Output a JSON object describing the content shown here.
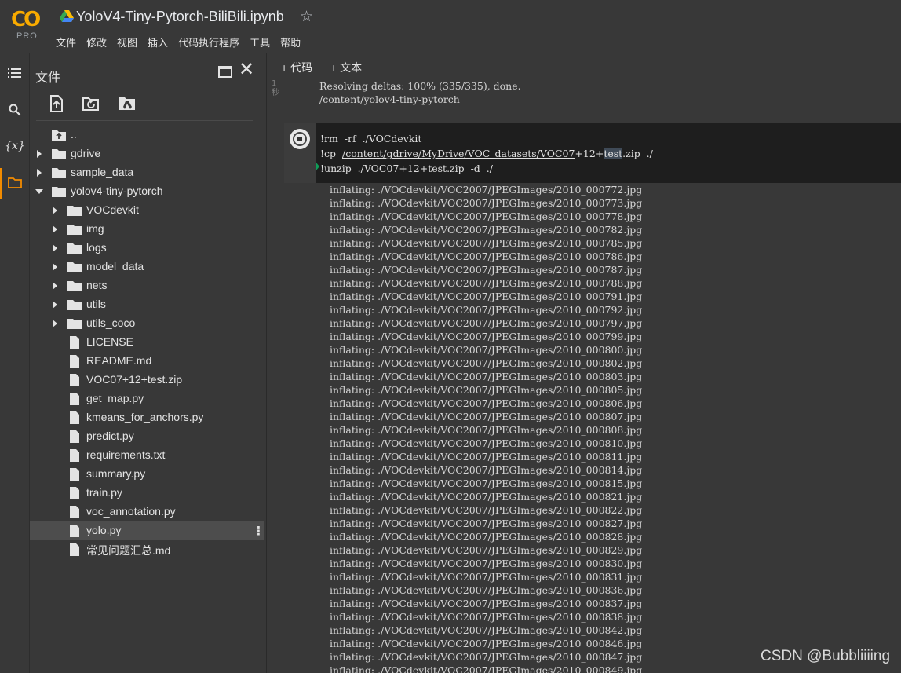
{
  "header": {
    "logo_text": "CO",
    "logo_badge": "PRO",
    "notebook_title": "YoloV4-Tiny-Pytorch-BiliBili.ipynb",
    "menu": [
      "文件",
      "修改",
      "视图",
      "插入",
      "代码执行程序",
      "工具",
      "帮助"
    ]
  },
  "rail": {
    "icons": [
      "menu-icon",
      "search-icon",
      "variables-icon",
      "folder-icon"
    ],
    "variables_glyph": "{x}"
  },
  "sidebar": {
    "title": "文件",
    "tools": [
      "upload-icon",
      "refresh-icon",
      "mount-drive-icon"
    ],
    "tree": [
      {
        "label": "..",
        "type": "up",
        "depth": 0,
        "caret": "none"
      },
      {
        "label": "gdrive",
        "type": "folder",
        "depth": 0,
        "caret": "right"
      },
      {
        "label": "sample_data",
        "type": "folder",
        "depth": 0,
        "caret": "right"
      },
      {
        "label": "yolov4-tiny-pytorch",
        "type": "folder",
        "depth": 0,
        "caret": "down"
      },
      {
        "label": "VOCdevkit",
        "type": "folder",
        "depth": 1,
        "caret": "right"
      },
      {
        "label": "img",
        "type": "folder",
        "depth": 1,
        "caret": "right"
      },
      {
        "label": "logs",
        "type": "folder",
        "depth": 1,
        "caret": "right"
      },
      {
        "label": "model_data",
        "type": "folder",
        "depth": 1,
        "caret": "right"
      },
      {
        "label": "nets",
        "type": "folder",
        "depth": 1,
        "caret": "right"
      },
      {
        "label": "utils",
        "type": "folder",
        "depth": 1,
        "caret": "right"
      },
      {
        "label": "utils_coco",
        "type": "folder",
        "depth": 1,
        "caret": "right"
      },
      {
        "label": "LICENSE",
        "type": "file",
        "depth": 1,
        "caret": "none"
      },
      {
        "label": "README.md",
        "type": "file",
        "depth": 1,
        "caret": "none"
      },
      {
        "label": "VOC07+12+test.zip",
        "type": "file",
        "depth": 1,
        "caret": "none"
      },
      {
        "label": "get_map.py",
        "type": "file",
        "depth": 1,
        "caret": "none"
      },
      {
        "label": "kmeans_for_anchors.py",
        "type": "file",
        "depth": 1,
        "caret": "none"
      },
      {
        "label": "predict.py",
        "type": "file",
        "depth": 1,
        "caret": "none"
      },
      {
        "label": "requirements.txt",
        "type": "file",
        "depth": 1,
        "caret": "none"
      },
      {
        "label": "summary.py",
        "type": "file",
        "depth": 1,
        "caret": "none"
      },
      {
        "label": "train.py",
        "type": "file",
        "depth": 1,
        "caret": "none"
      },
      {
        "label": "voc_annotation.py",
        "type": "file",
        "depth": 1,
        "caret": "none"
      },
      {
        "label": "yolo.py",
        "type": "file",
        "depth": 1,
        "caret": "none",
        "selected": true
      },
      {
        "label": "常见问题汇总.md",
        "type": "file",
        "depth": 1,
        "caret": "none"
      }
    ]
  },
  "main": {
    "add_code": "+ 代码",
    "add_text": "+ 文本",
    "prev_exec": "1\n秒",
    "prev_output": [
      "Resolving deltas: 100% (335/335), done.",
      "/content/yolov4-tiny-pytorch"
    ],
    "code_line1": "!rm  -rf  ./VOCdevkit",
    "code_line2_prefix": "!cp  ",
    "code_line2_link_a": "/content/gdrive/MyDrive/VOC_datasets/VOC07",
    "code_line2_plus": "+12+",
    "code_line2_hl": "test",
    "code_line2_rest": ".zip  ./",
    "code_line3": "!unzip  ./VOC07+12+test.zip  -d  ./",
    "output_prefix": "inflating: ./VOCdevkit/VOC2007/JPEGImages/",
    "output_files": [
      "2010_000772.jpg",
      "2010_000773.jpg",
      "2010_000778.jpg",
      "2010_000782.jpg",
      "2010_000785.jpg",
      "2010_000786.jpg",
      "2010_000787.jpg",
      "2010_000788.jpg",
      "2010_000791.jpg",
      "2010_000792.jpg",
      "2010_000797.jpg",
      "2010_000799.jpg",
      "2010_000800.jpg",
      "2010_000802.jpg",
      "2010_000803.jpg",
      "2010_000805.jpg",
      "2010_000806.jpg",
      "2010_000807.jpg",
      "2010_000808.jpg",
      "2010_000810.jpg",
      "2010_000811.jpg",
      "2010_000814.jpg",
      "2010_000815.jpg",
      "2010_000821.jpg",
      "2010_000822.jpg",
      "2010_000827.jpg",
      "2010_000828.jpg",
      "2010_000829.jpg",
      "2010_000830.jpg",
      "2010_000831.jpg",
      "2010_000836.jpg",
      "2010_000837.jpg",
      "2010_000838.jpg",
      "2010_000842.jpg",
      "2010_000846.jpg",
      "2010_000847.jpg",
      "2010_000849.jpg"
    ]
  },
  "watermark": "CSDN @Bubbliiiing",
  "colors": {
    "background": "#383838",
    "accent": "#f9ab00",
    "code_bg": "#1e1e1e",
    "selected_row": "#4d4d4d"
  }
}
